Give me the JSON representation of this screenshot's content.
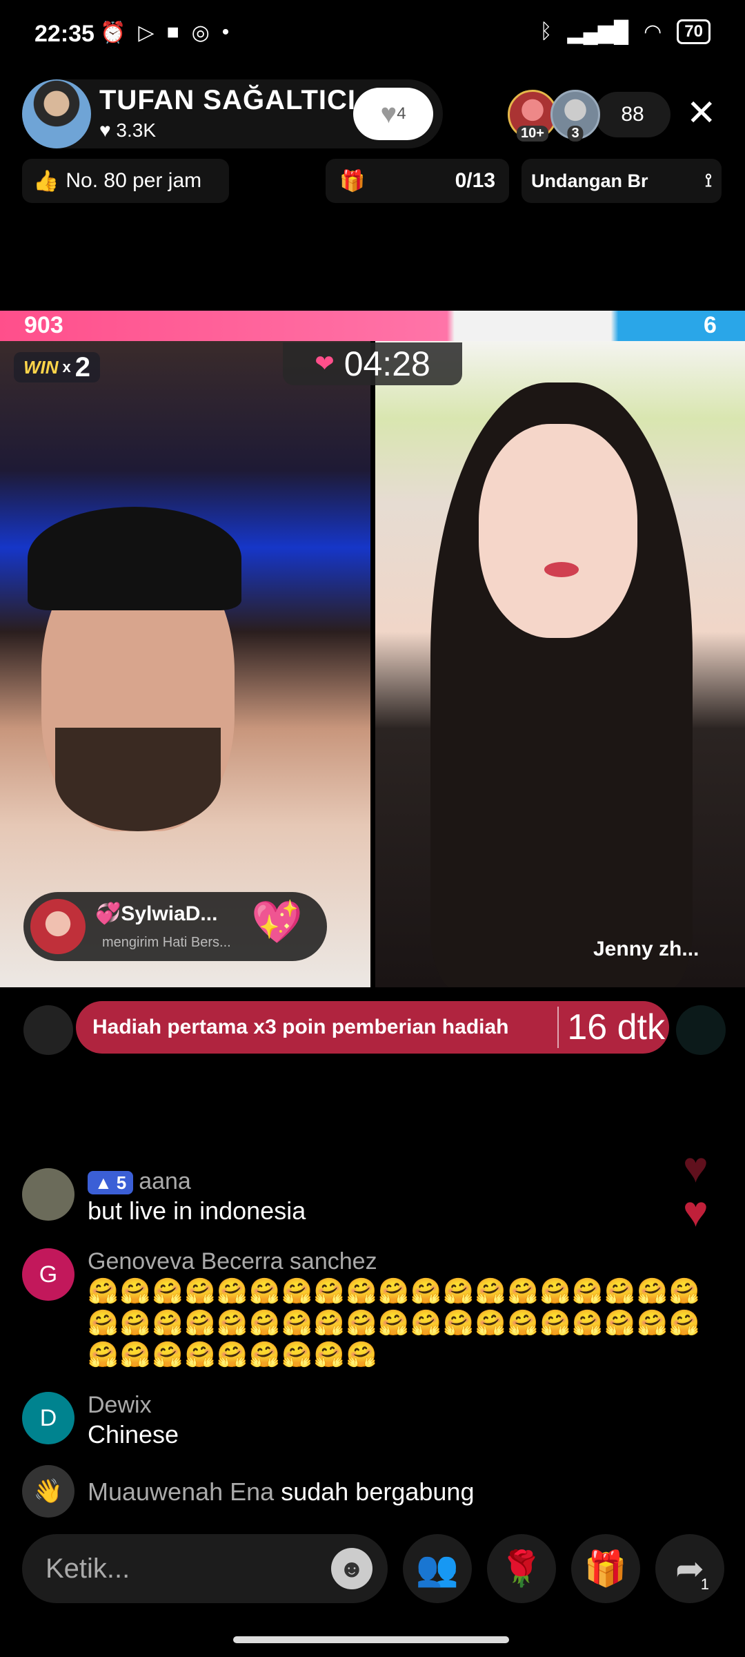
{
  "status_bar": {
    "time": "22:35",
    "left_icons": [
      "alarm-icon",
      "play-icon",
      "video-camera-icon",
      "recording-icon",
      "dot-icon"
    ],
    "right_icons": [
      "bluetooth-icon",
      "signal-icon",
      "wifi-icon"
    ],
    "battery": "70"
  },
  "host": {
    "name": "TUFAN SAĞALTICI",
    "likes": "♥ 3.3K",
    "follow_count": "4"
  },
  "viewers": {
    "badge_a": "10+",
    "badge_b": "3",
    "count": "88"
  },
  "top_pills": {
    "rank": "No. 80 per jam",
    "goal_progress": "0/13",
    "invite": "Undangan Br"
  },
  "battle": {
    "score_left": "903",
    "score_right": "6",
    "win_label": "WIN",
    "win_x": "x",
    "win_count": "2",
    "timer": "04:28",
    "opponent_name": "Jenny zh..."
  },
  "gift_toast": {
    "sender": "💞SylwiaD...",
    "message": "mengirim Hati Bers..."
  },
  "promo": {
    "text": "Hadiah pertama x3 poin pemberian hadiah",
    "countdown": "16 dtk"
  },
  "comments": [
    {
      "avatar": "",
      "level": "5",
      "name": "aana",
      "text": "but live in indonesia",
      "color": "#6b6b5a"
    },
    {
      "avatar": "G",
      "name": "Genoveva Becerra sanchez",
      "text": "🤗🤗🤗🤗🤗🤗🤗🤗🤗🤗🤗🤗🤗🤗🤗🤗🤗🤗🤗🤗🤗🤗🤗🤗🤗🤗🤗🤗🤗🤗🤗🤗🤗🤗🤗🤗🤗🤗🤗🤗🤗🤗🤗🤗🤗🤗🤗",
      "color": "#c2185b"
    },
    {
      "avatar": "D",
      "name": "Dewix",
      "text": "Chinese",
      "color": "#00838f"
    }
  ],
  "joined": {
    "name": "Muauwenah Ena",
    "text": "sudah bergabung"
  },
  "bottom_bar": {
    "input_placeholder": "Ketik...",
    "share_count": "1"
  }
}
